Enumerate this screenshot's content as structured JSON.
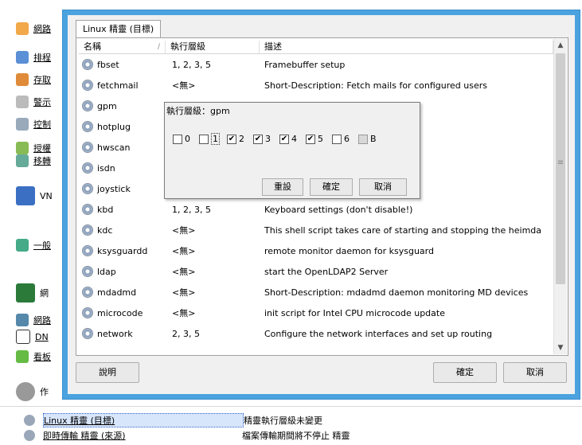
{
  "background": {
    "left_items": [
      {
        "label": "網路"
      },
      {
        "label": "排程"
      },
      {
        "label": "存取"
      },
      {
        "label": "警示"
      },
      {
        "label": "控制"
      },
      {
        "label": "授權"
      },
      {
        "label": "移轉"
      },
      {
        "label": "VN"
      },
      {
        "label": "一般"
      },
      {
        "label": "網"
      },
      {
        "label": "網路"
      },
      {
        "label": "DN"
      },
      {
        "label": "看板"
      },
      {
        "label": "作"
      }
    ],
    "bottom_rows": [
      {
        "link": "Linux 精靈 (目標)",
        "desc": "精靈執行層級未變更",
        "selected": true
      },
      {
        "link": "即時傳輸 精靈 (來源)",
        "desc": "檔案傳輸期間將不停止 精靈",
        "selected": false
      }
    ]
  },
  "dialog": {
    "tab_label": "Linux 精靈 (目標)",
    "columns": {
      "name": "名稱",
      "runlevel": "執行層級",
      "description": "描述"
    },
    "rows": [
      {
        "name": "fbset",
        "runlevel": "1, 2, 3, 5",
        "description": "Framebuffer setup"
      },
      {
        "name": "fetchmail",
        "runlevel": "<無>",
        "description": "Short-Description: Fetch mails for configured users"
      },
      {
        "name": "gpm",
        "runlevel": "",
        "description": "e"
      },
      {
        "name": "hotplug",
        "runlevel": "",
        "description": "ic initialisation of hotplugge"
      },
      {
        "name": "hwscan",
        "runlevel": "",
        "description": "on boot."
      },
      {
        "name": "isdn",
        "runlevel": "",
        "description": "DN drivers"
      },
      {
        "name": "joystick",
        "runlevel": "",
        "description": ""
      },
      {
        "name": "kbd",
        "runlevel": "1, 2, 3, 5",
        "description": "Keyboard settings (don't disable!)"
      },
      {
        "name": "kdc",
        "runlevel": "<無>",
        "description": "This shell script takes care of starting and stopping the heimda"
      },
      {
        "name": "ksysguardd",
        "runlevel": "<無>",
        "description": "remote monitor daemon for ksysguard"
      },
      {
        "name": "ldap",
        "runlevel": "<無>",
        "description": "start the OpenLDAP2 Server"
      },
      {
        "name": "mdadmd",
        "runlevel": "<無>",
        "description": "Short-Description: mdadmd daemon monitoring MD devices"
      },
      {
        "name": "microcode",
        "runlevel": "<無>",
        "description": "init script for Intel CPU microcode update"
      },
      {
        "name": "network",
        "runlevel": "2, 3, 5",
        "description": "Configure the network interfaces and set up routing"
      }
    ],
    "help_label": "說明",
    "ok_label": "確定",
    "cancel_label": "取消"
  },
  "popup": {
    "title": "執行層級：gpm",
    "levels": [
      {
        "label": "0",
        "checked": false
      },
      {
        "label": "1",
        "checked": false
      },
      {
        "label": "2",
        "checked": true
      },
      {
        "label": "3",
        "checked": true
      },
      {
        "label": "4",
        "checked": true
      },
      {
        "label": "5",
        "checked": true
      },
      {
        "label": "6",
        "checked": false
      },
      {
        "label": "B",
        "checked": false
      }
    ],
    "reset_label": "重設",
    "ok_label": "確定",
    "cancel_label": "取消"
  },
  "colors": {
    "frame": "#4aa3df",
    "panel": "#f0f0f0"
  }
}
